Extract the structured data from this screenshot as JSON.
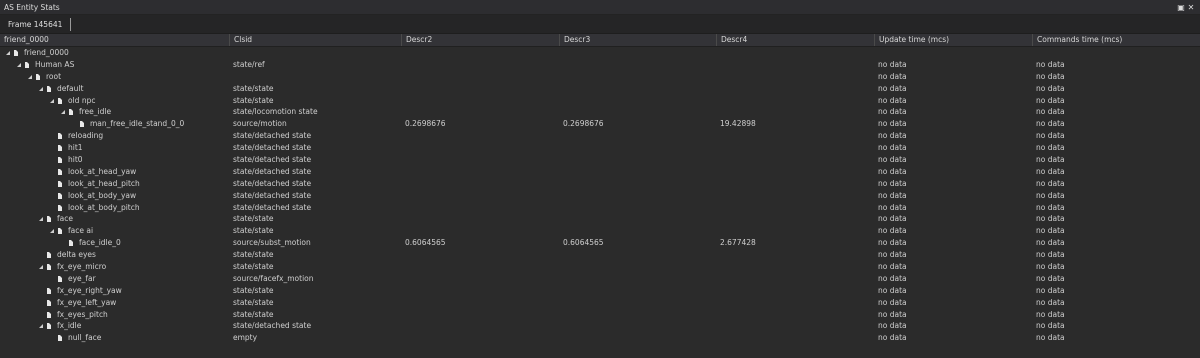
{
  "window": {
    "title": "AS Entity Stats",
    "pin_glyph": "▣",
    "close_glyph": "✕"
  },
  "toolbar": {
    "frame_label": "Frame 145641"
  },
  "columns": [
    "friend_0000",
    "Clsid",
    "Descr2",
    "Descr3",
    "Descr4",
    "Update time (mcs)",
    "Commands time (mcs)"
  ],
  "rows": [
    {
      "name": "friend_0000",
      "depth": 0,
      "expand": true,
      "clsid": "",
      "d2": "",
      "d3": "",
      "d4": "",
      "update": "",
      "commands": ""
    },
    {
      "name": "Human AS",
      "depth": 1,
      "expand": true,
      "clsid": "state/ref",
      "d2": "",
      "d3": "",
      "d4": "",
      "update": "no data",
      "commands": "no data"
    },
    {
      "name": "root",
      "depth": 2,
      "expand": true,
      "clsid": "",
      "d2": "",
      "d3": "",
      "d4": "",
      "update": "no data",
      "commands": "no data"
    },
    {
      "name": "default",
      "depth": 3,
      "expand": true,
      "clsid": "state/state",
      "d2": "",
      "d3": "",
      "d4": "",
      "update": "no data",
      "commands": "no data"
    },
    {
      "name": "old npc",
      "depth": 4,
      "expand": true,
      "clsid": "state/state",
      "d2": "",
      "d3": "",
      "d4": "",
      "update": "no data",
      "commands": "no data"
    },
    {
      "name": "free_idle",
      "depth": 5,
      "expand": true,
      "clsid": "state/locomotion state",
      "d2": "",
      "d3": "",
      "d4": "",
      "update": "no data",
      "commands": "no data"
    },
    {
      "name": "man_free_idle_stand_0_0",
      "depth": 6,
      "expand": false,
      "clsid": "source/motion",
      "d2": "0.2698676",
      "d3": "0.2698676",
      "d4": "19.42898",
      "update": "no data",
      "commands": "no data"
    },
    {
      "name": "reloading",
      "depth": 4,
      "expand": false,
      "clsid": "state/detached state",
      "d2": "",
      "d3": "",
      "d4": "",
      "update": "no data",
      "commands": "no data"
    },
    {
      "name": "hit1",
      "depth": 4,
      "expand": false,
      "clsid": "state/detached state",
      "d2": "",
      "d3": "",
      "d4": "",
      "update": "no data",
      "commands": "no data"
    },
    {
      "name": "hit0",
      "depth": 4,
      "expand": false,
      "clsid": "state/detached state",
      "d2": "",
      "d3": "",
      "d4": "",
      "update": "no data",
      "commands": "no data"
    },
    {
      "name": "look_at_head_yaw",
      "depth": 4,
      "expand": false,
      "clsid": "state/detached state",
      "d2": "",
      "d3": "",
      "d4": "",
      "update": "no data",
      "commands": "no data"
    },
    {
      "name": "look_at_head_pitch",
      "depth": 4,
      "expand": false,
      "clsid": "state/detached state",
      "d2": "",
      "d3": "",
      "d4": "",
      "update": "no data",
      "commands": "no data"
    },
    {
      "name": "look_at_body_yaw",
      "depth": 4,
      "expand": false,
      "clsid": "state/detached state",
      "d2": "",
      "d3": "",
      "d4": "",
      "update": "no data",
      "commands": "no data"
    },
    {
      "name": "look_at_body_pitch",
      "depth": 4,
      "expand": false,
      "clsid": "state/detached state",
      "d2": "",
      "d3": "",
      "d4": "",
      "update": "no data",
      "commands": "no data"
    },
    {
      "name": "face",
      "depth": 3,
      "expand": true,
      "clsid": "state/state",
      "d2": "",
      "d3": "",
      "d4": "",
      "update": "no data",
      "commands": "no data"
    },
    {
      "name": "face ai",
      "depth": 4,
      "expand": true,
      "clsid": "state/state",
      "d2": "",
      "d3": "",
      "d4": "",
      "update": "no data",
      "commands": "no data"
    },
    {
      "name": "face_idle_0",
      "depth": 5,
      "expand": false,
      "clsid": "source/subst_motion",
      "d2": "0.6064565",
      "d3": "0.6064565",
      "d4": "2.677428",
      "update": "no data",
      "commands": "no data"
    },
    {
      "name": "delta eyes",
      "depth": 3,
      "expand": false,
      "clsid": "state/state",
      "d2": "",
      "d3": "",
      "d4": "",
      "update": "no data",
      "commands": "no data"
    },
    {
      "name": "fx_eye_micro",
      "depth": 3,
      "expand": true,
      "clsid": "state/state",
      "d2": "",
      "d3": "",
      "d4": "",
      "update": "no data",
      "commands": "no data"
    },
    {
      "name": "eye_far",
      "depth": 4,
      "expand": false,
      "clsid": "source/facefx_motion",
      "d2": "",
      "d3": "",
      "d4": "",
      "update": "no data",
      "commands": "no data"
    },
    {
      "name": "fx_eye_right_yaw",
      "depth": 3,
      "expand": false,
      "clsid": "state/state",
      "d2": "",
      "d3": "",
      "d4": "",
      "update": "no data",
      "commands": "no data"
    },
    {
      "name": "fx_eye_left_yaw",
      "depth": 3,
      "expand": false,
      "clsid": "state/state",
      "d2": "",
      "d3": "",
      "d4": "",
      "update": "no data",
      "commands": "no data"
    },
    {
      "name": "fx_eyes_pitch",
      "depth": 3,
      "expand": false,
      "clsid": "state/state",
      "d2": "",
      "d3": "",
      "d4": "",
      "update": "no data",
      "commands": "no data"
    },
    {
      "name": "fx_idle",
      "depth": 3,
      "expand": true,
      "clsid": "state/detached state",
      "d2": "",
      "d3": "",
      "d4": "",
      "update": "no data",
      "commands": "no data"
    },
    {
      "name": "null_face",
      "depth": 4,
      "expand": false,
      "clsid": "empty",
      "d2": "",
      "d3": "",
      "d4": "",
      "update": "no data",
      "commands": "no data"
    }
  ]
}
